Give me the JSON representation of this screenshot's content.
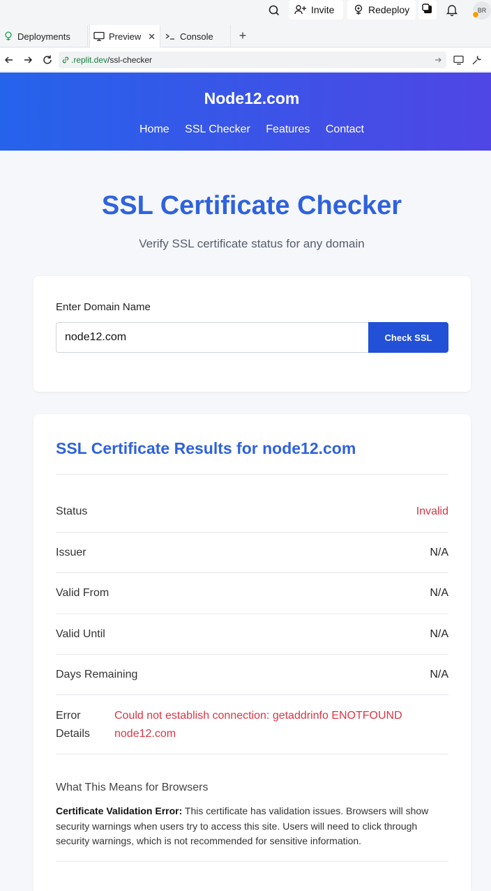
{
  "topbar": {
    "invite_label": "Invite",
    "redeploy_label": "Redeploy",
    "avatar_initials": "BR"
  },
  "tabs": [
    {
      "label": "Deployments",
      "icon": "deployments-icon"
    },
    {
      "label": "Preview",
      "icon": "monitor-icon"
    },
    {
      "label": "Console",
      "icon": "terminal-icon"
    }
  ],
  "url": {
    "host": ".replit.dev",
    "path": "/ssl-checker"
  },
  "site": {
    "brand": "Node12.com",
    "nav": [
      "Home",
      "SSL Checker",
      "Features",
      "Contact"
    ]
  },
  "hero": {
    "title": "SSL Certificate Checker",
    "subtitle": "Verify SSL certificate status for any domain"
  },
  "form": {
    "label": "Enter Domain Name",
    "domain_value": "node12.com",
    "button_label": "Check SSL"
  },
  "results": {
    "title": "SSL Certificate Results for node12.com",
    "rows": [
      {
        "label": "Status",
        "value": "Invalid"
      },
      {
        "label": "Issuer",
        "value": "N/A"
      },
      {
        "label": "Valid From",
        "value": "N/A"
      },
      {
        "label": "Valid Until",
        "value": "N/A"
      },
      {
        "label": "Days Remaining",
        "value": "N/A"
      }
    ],
    "error_label": "Error Details",
    "error_value": "Could not establish connection: getaddrinfo ENOTFOUND node12.com",
    "means_title": "What This Means for Browsers",
    "means_strong": "Certificate Validation Error:",
    "means_text": " This certificate has validation issues. Browsers will show security warnings when users try to access this site. Users will need to click through security warnings, which is not recommended for sensitive information."
  },
  "colors": {
    "accent": "#2f62dd",
    "header_start": "#2563eb",
    "header_end": "#4f46e5",
    "error": "#dc3545",
    "button": "#2250d6"
  }
}
